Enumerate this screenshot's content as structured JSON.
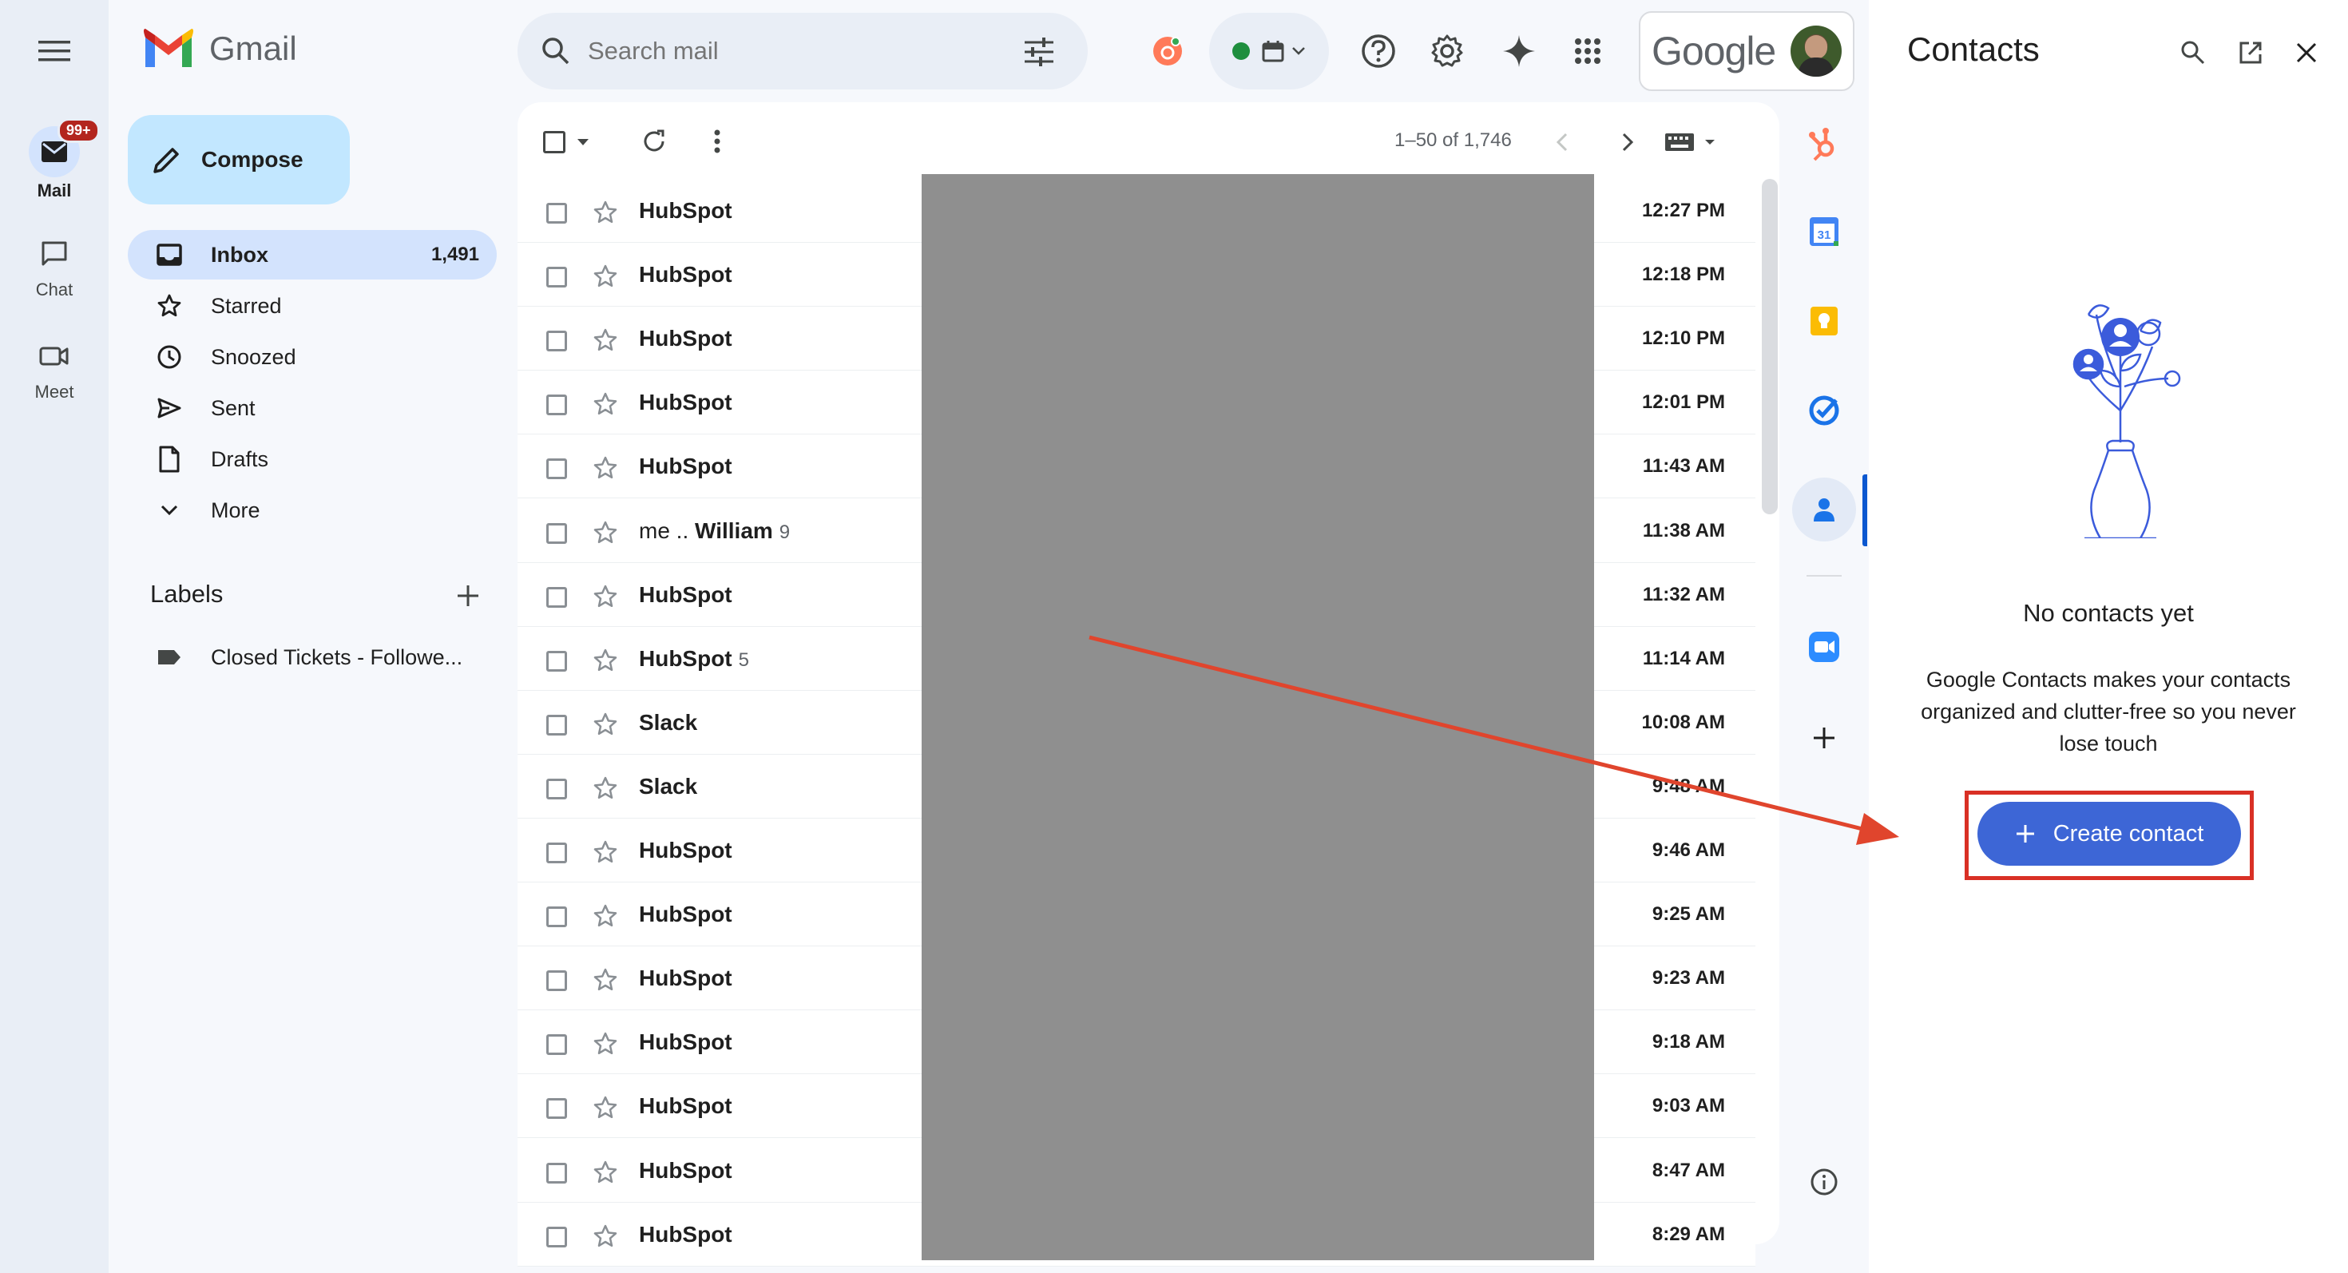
{
  "app": {
    "name": "Gmail"
  },
  "rail": {
    "mail_label": "Mail",
    "mail_badge": "99+",
    "chat_label": "Chat",
    "meet_label": "Meet"
  },
  "search": {
    "placeholder": "Search mail"
  },
  "account": {
    "brand": "Google"
  },
  "compose": {
    "label": "Compose"
  },
  "nav": {
    "inbox": {
      "label": "Inbox",
      "count": "1,491"
    },
    "starred": {
      "label": "Starred"
    },
    "snoozed": {
      "label": "Snoozed"
    },
    "sent": {
      "label": "Sent"
    },
    "drafts": {
      "label": "Drafts"
    },
    "more": {
      "label": "More"
    }
  },
  "labels": {
    "heading": "Labels",
    "items": [
      {
        "label": "Closed Tickets - Followe..."
      }
    ]
  },
  "toolbar": {
    "pagination": "1–50 of 1,746"
  },
  "emails": [
    {
      "sender": "HubSpot",
      "time": "12:27 PM"
    },
    {
      "sender": "HubSpot",
      "time": "12:18 PM"
    },
    {
      "sender": "HubSpot",
      "time": "12:10 PM"
    },
    {
      "sender": "HubSpot",
      "time": "12:01 PM"
    },
    {
      "sender": "HubSpot",
      "time": "11:43 AM"
    },
    {
      "sender_prefix": "me .. ",
      "sender": "William",
      "count": "9",
      "time": "11:38 AM"
    },
    {
      "sender": "HubSpot",
      "time": "11:32 AM"
    },
    {
      "sender": "HubSpot",
      "count": "5",
      "time": "11:14 AM"
    },
    {
      "sender": "Slack",
      "time": "10:08 AM"
    },
    {
      "sender": "Slack",
      "time": "9:48 AM"
    },
    {
      "sender": "HubSpot",
      "time": "9:46 AM"
    },
    {
      "sender": "HubSpot",
      "time": "9:25 AM"
    },
    {
      "sender": "HubSpot",
      "time": "9:23 AM"
    },
    {
      "sender": "HubSpot",
      "time": "9:18 AM"
    },
    {
      "sender": "HubSpot",
      "time": "9:03 AM"
    },
    {
      "sender": "HubSpot",
      "time": "8:47 AM"
    },
    {
      "sender": "HubSpot",
      "time": "8:29 AM"
    }
  ],
  "contacts_panel": {
    "title": "Contacts",
    "empty_title": "No contacts yet",
    "empty_line1": "Google Contacts makes your contacts",
    "empty_line2": "organized and clutter-free so you never",
    "empty_line3": "lose touch",
    "create_label": "Create contact"
  },
  "colors": {
    "accent_blue": "#0b57d0",
    "nav_active": "#d3e3fd",
    "annotation_red": "#e0452d",
    "redaction_gray": "#8f8f8f"
  }
}
